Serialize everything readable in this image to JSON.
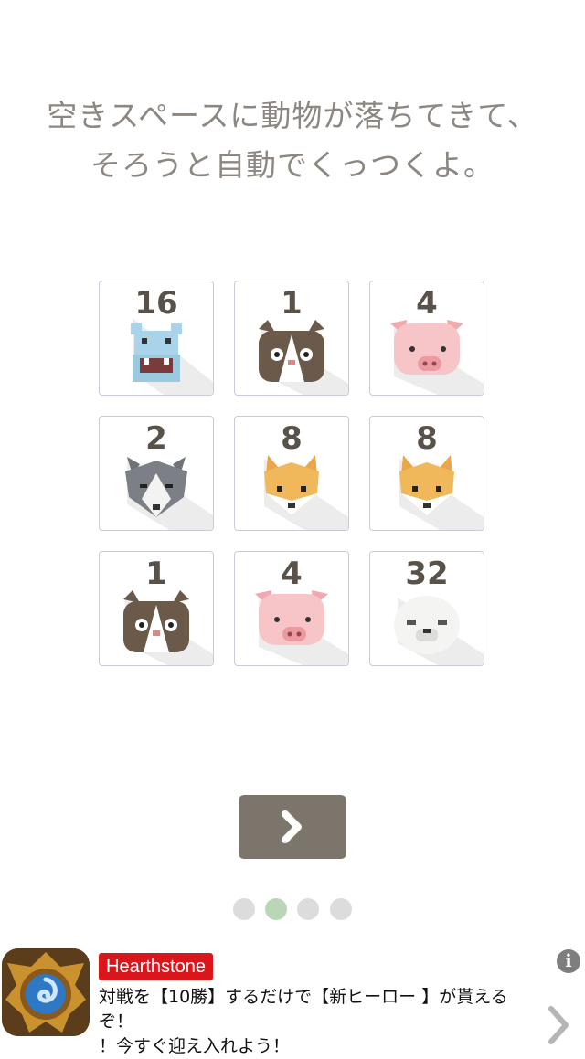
{
  "instructions": {
    "line1": "空きスペースに動物が落ちてきて、",
    "line2": "そろうと自動でくっつくよ。"
  },
  "grid": {
    "tiles": [
      {
        "number": "16",
        "animal": "hippo-icon"
      },
      {
        "number": "1",
        "animal": "cat-icon"
      },
      {
        "number": "4",
        "animal": "pig-icon"
      },
      {
        "number": "2",
        "animal": "wolf-icon"
      },
      {
        "number": "8",
        "animal": "fox-icon"
      },
      {
        "number": "8",
        "animal": "fox-icon"
      },
      {
        "number": "1",
        "animal": "cat-icon"
      },
      {
        "number": "4",
        "animal": "pig-icon"
      },
      {
        "number": "32",
        "animal": "seal-icon"
      }
    ]
  },
  "navigation": {
    "next_icon": "chevron-right-icon",
    "page_count": 4,
    "current_page": 2
  },
  "colors": {
    "text": "#8c8780",
    "button": "#7b756c",
    "active_dot": "#b9d7b7",
    "inactive_dot": "#dcdcdc",
    "ad_brand_bg": "#d8161b"
  },
  "ad": {
    "brand": "Hearthstone",
    "line1": "対戦を【10勝】するだけで【新ヒーロー 】が貰えるぞ！",
    "line2": "！今すぐ迎え入れよう！",
    "info_label": "i"
  }
}
